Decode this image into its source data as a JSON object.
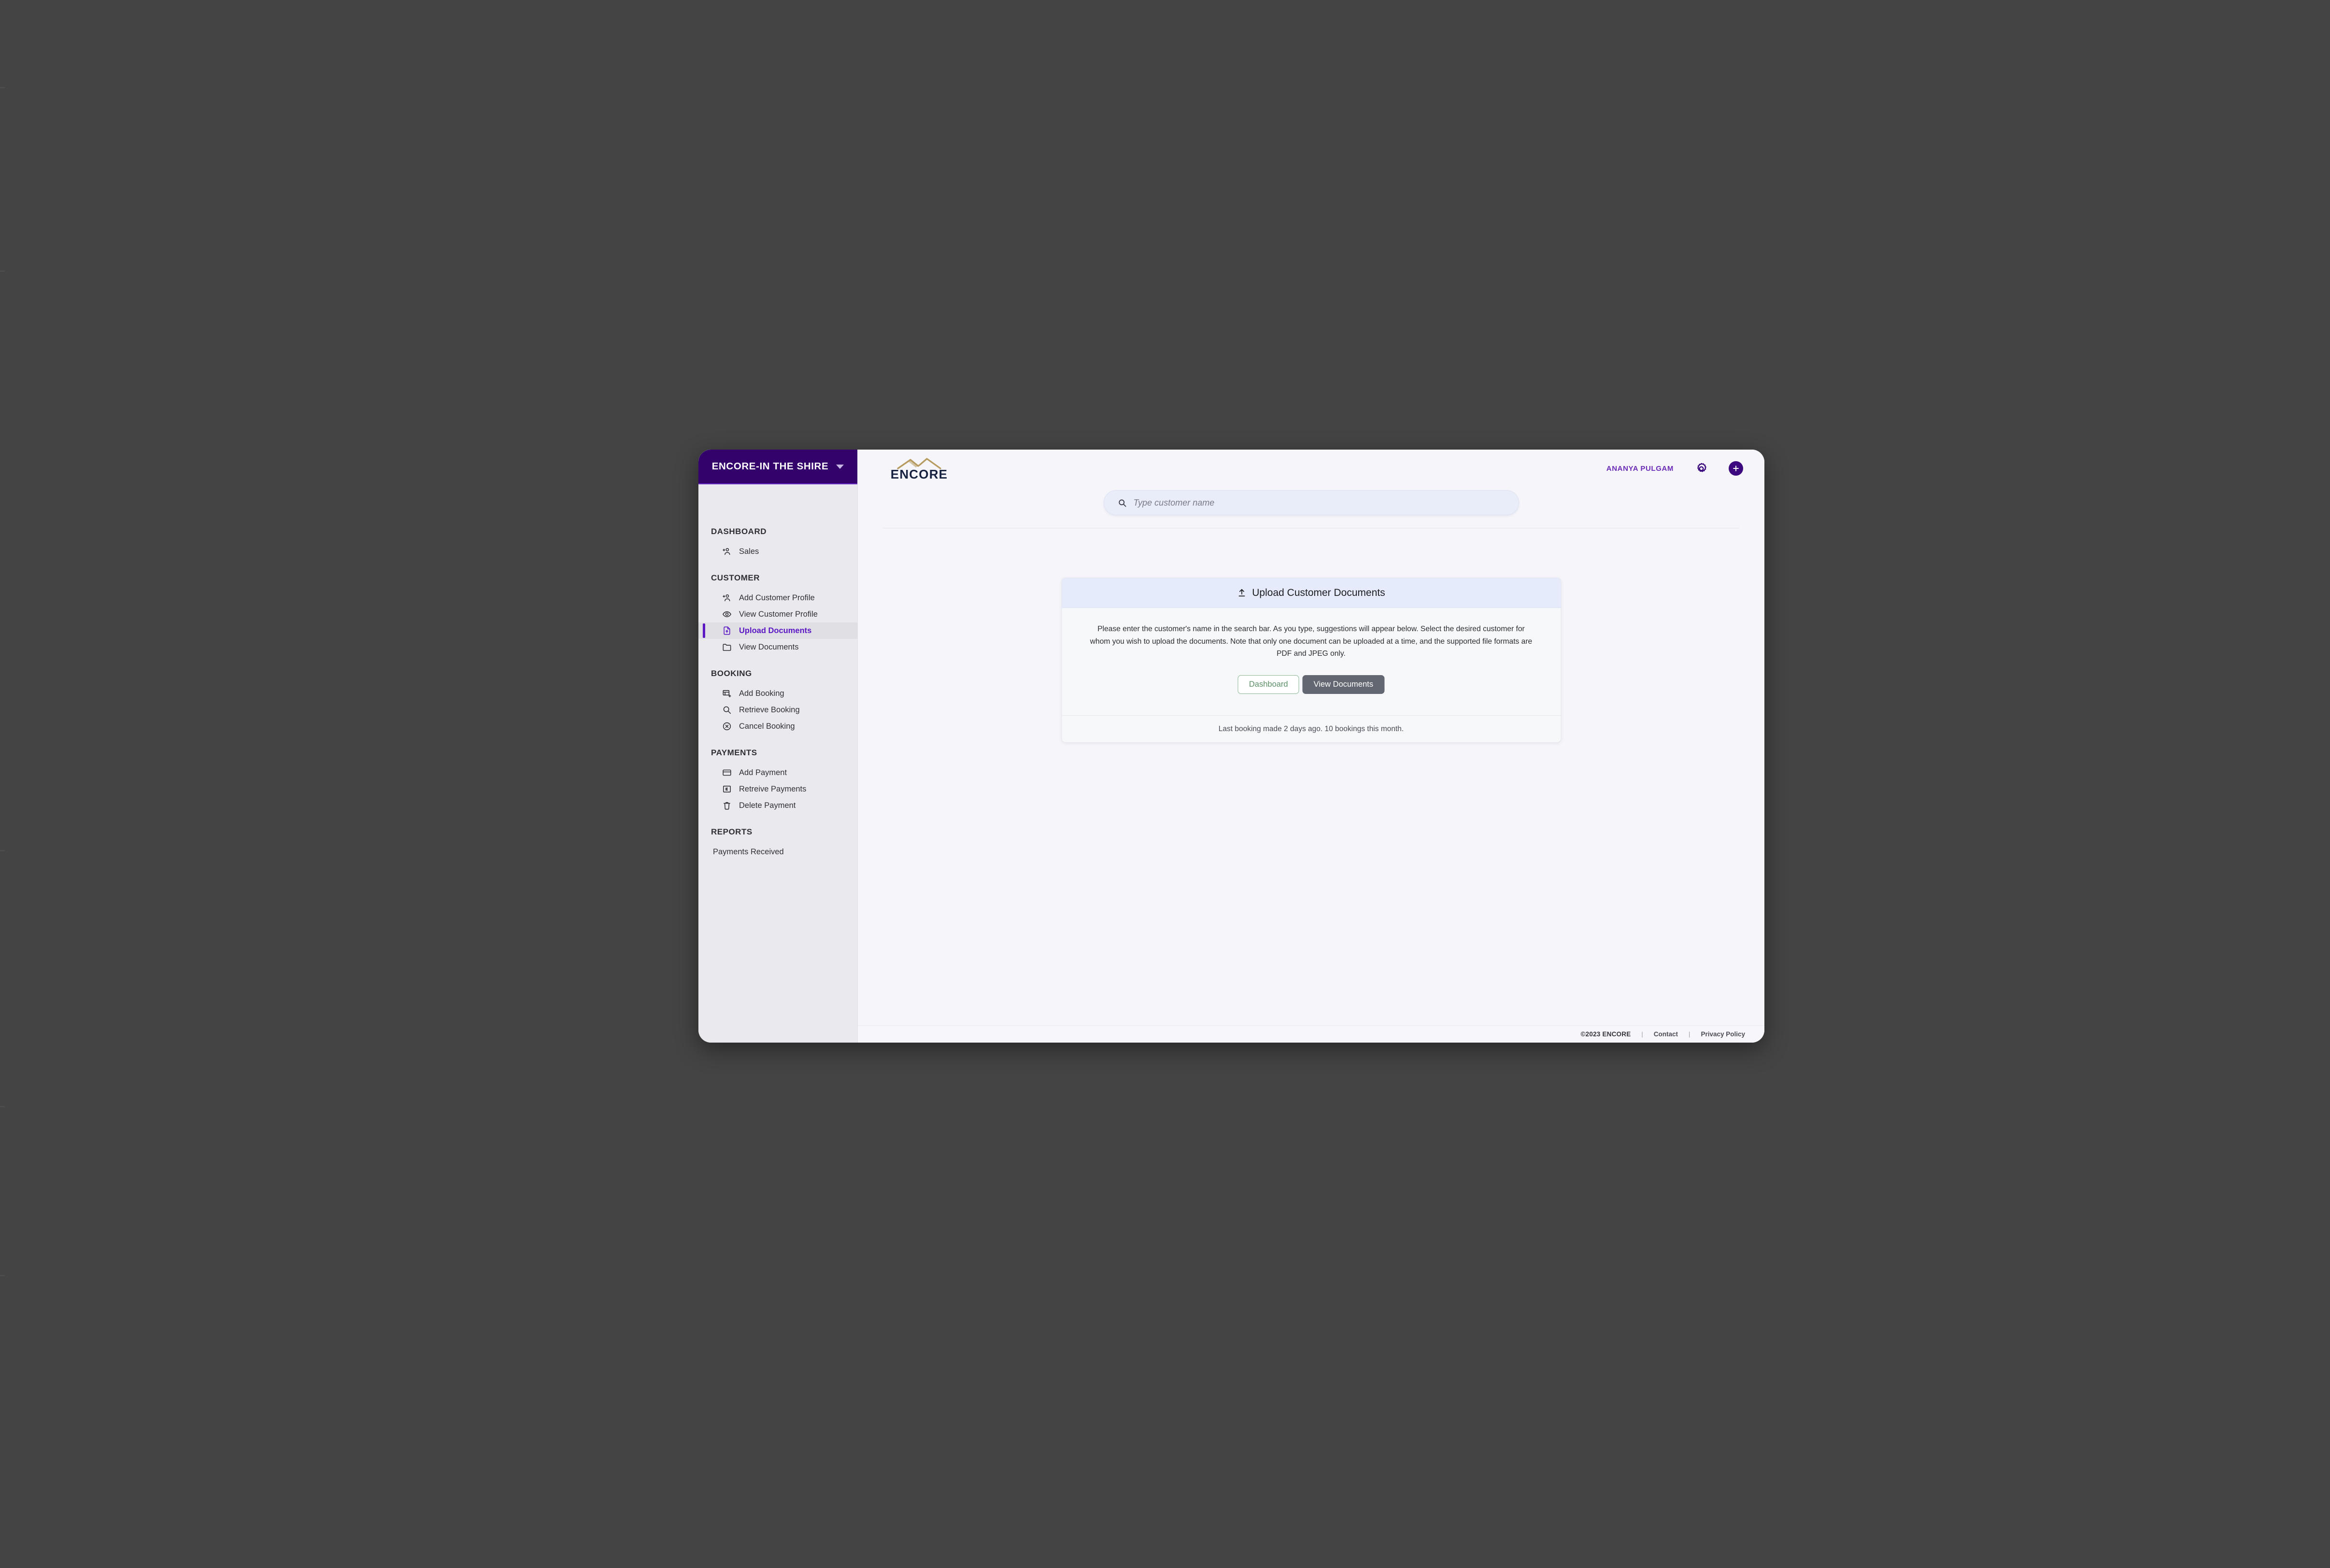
{
  "window": {
    "brand": {
      "title": "ENCORE-IN THE SHIRE",
      "caret_icon": "chevron-down-icon"
    }
  },
  "sidebar": {
    "groups": [
      {
        "label": "DASHBOARD",
        "items": [
          {
            "label": "Sales",
            "icon": "person-add-icon",
            "active": false
          }
        ]
      },
      {
        "label": "CUSTOMER",
        "items": [
          {
            "label": "Add Customer Profile",
            "icon": "person-add-icon",
            "active": false
          },
          {
            "label": "View Customer Profile",
            "icon": "eye-icon",
            "active": false
          },
          {
            "label": "Upload Documents",
            "icon": "file-upload-icon",
            "active": true
          },
          {
            "label": "View Documents",
            "icon": "folder-icon",
            "active": false
          }
        ]
      },
      {
        "label": "BOOKING",
        "items": [
          {
            "label": "Add Booking",
            "icon": "booking-add-icon",
            "active": false
          },
          {
            "label": "Retrieve Booking",
            "icon": "search-icon",
            "active": false
          },
          {
            "label": "Cancel Booking",
            "icon": "circle-x-icon",
            "active": false
          }
        ]
      },
      {
        "label": "PAYMENTS",
        "items": [
          {
            "label": "Add Payment",
            "icon": "credit-card-icon",
            "active": false
          },
          {
            "label": "Retreive Payments",
            "icon": "receipt-icon",
            "active": false
          },
          {
            "label": "Delete Payment",
            "icon": "trash-icon",
            "active": false
          }
        ]
      },
      {
        "label": "REPORTS",
        "items": [
          {
            "label": "Payments Received",
            "icon": "",
            "active": false
          }
        ]
      }
    ]
  },
  "header": {
    "logo_word": "ENCORE",
    "logo_mark_icon": "mountain-peaks-icon",
    "user_name": "ANANYA PULGAM",
    "gear_icon": "gear-icon",
    "plus_icon": "plus-icon"
  },
  "search": {
    "icon": "search-icon",
    "value": "",
    "placeholder": "Type customer name"
  },
  "card": {
    "icon": "upload-icon",
    "title": "Upload Customer Documents",
    "description": "Please enter the customer's name in the search bar. As you type, suggestions will appear below. Select the desired customer for whom you wish to upload the documents. Note that only one document can be uploaded at a time, and the supported file formats are PDF and JPEG only.",
    "buttons": {
      "dashboard": "Dashboard",
      "view_documents": "View Documents"
    },
    "footer_text": "Last booking made 2 days ago. 10 bookings this month."
  },
  "page_footer": {
    "copyright": "©2023 ENCORE",
    "separator": "|",
    "contact": "Contact",
    "privacy": "Privacy Policy"
  },
  "colors": {
    "brand_purple": "#33026b",
    "accent_purple": "#5b17c4",
    "logo_navy": "#16213f",
    "logo_gold": "#b79a5e",
    "card_header_blue": "#e5ebfa",
    "button_gray": "#636771",
    "button_green": "#5d9068"
  }
}
